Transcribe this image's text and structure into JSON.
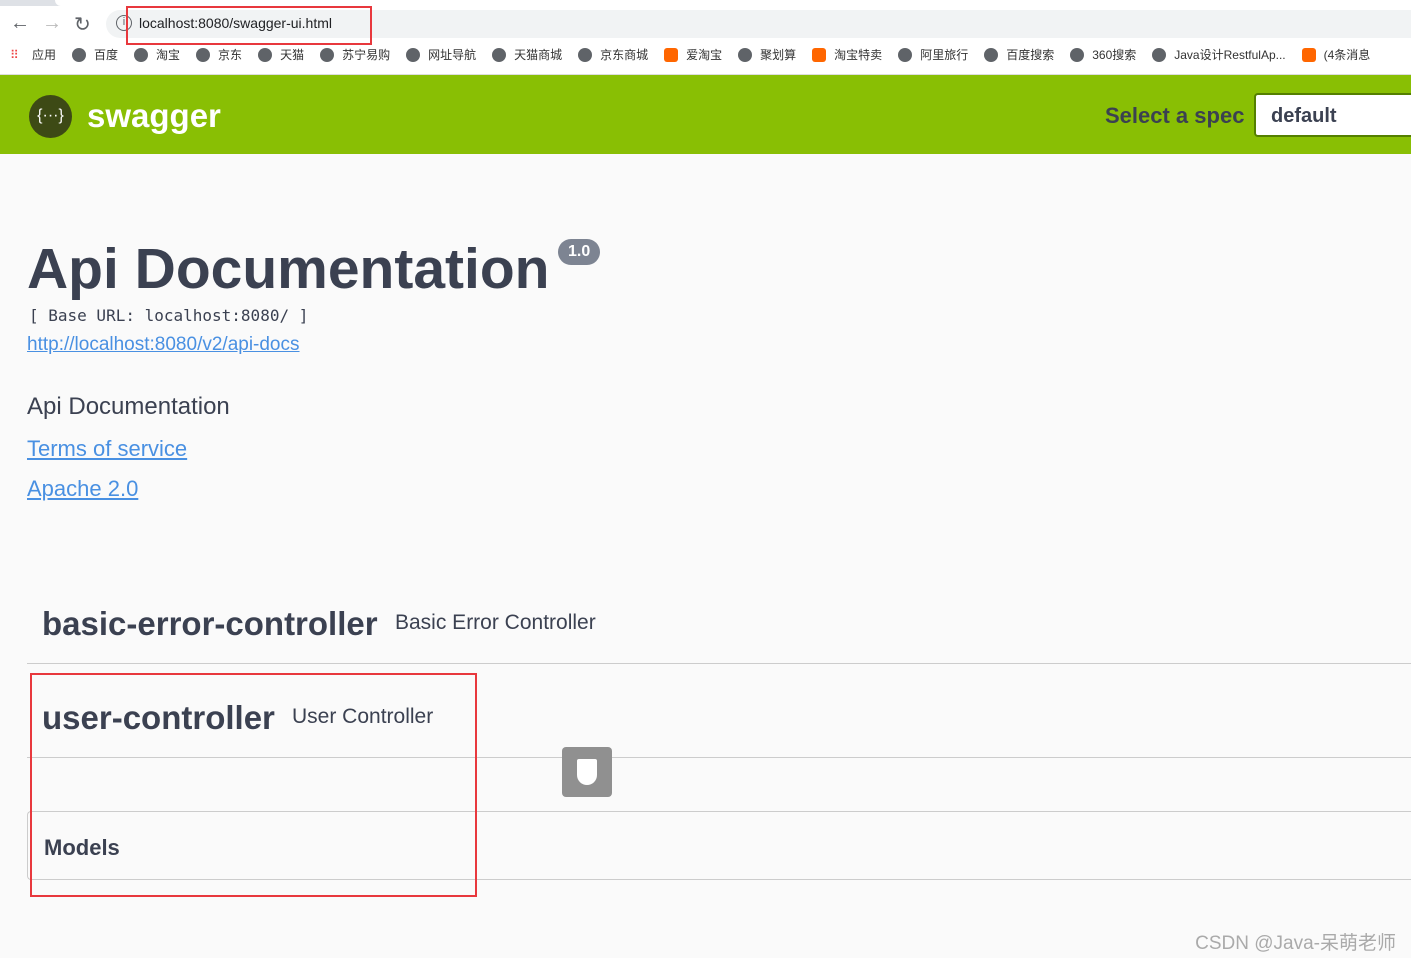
{
  "browser": {
    "url": "localhost:8080/swagger-ui.html",
    "bookmarks": [
      "应用",
      "百度",
      "淘宝",
      "京东",
      "天猫",
      "苏宁易购",
      "网址导航",
      "天猫商城",
      "京东商城",
      "爱淘宝",
      "聚划算",
      "淘宝特卖",
      "阿里旅行",
      "百度搜索",
      "360搜索",
      "Java设计RestfulAp...",
      "(4条消息"
    ]
  },
  "topbar": {
    "brand": "swagger",
    "logo_text": "{···}",
    "spec_label": "Select a spec",
    "spec_value": "default",
    "color": "#89bf04"
  },
  "info": {
    "title": "Api Documentation",
    "version": "1.0",
    "base_url": "[ Base URL: localhost:8080/ ]",
    "api_docs_link": "http://localhost:8080/v2/api-docs",
    "description": "Api Documentation",
    "terms": "Terms of service",
    "license": "Apache 2.0"
  },
  "tags": [
    {
      "name": "basic-error-controller",
      "description": "Basic Error Controller"
    },
    {
      "name": "user-controller",
      "description": "User Controller"
    }
  ],
  "models": {
    "label": "Models"
  },
  "watermark": "CSDN @Java-呆萌老师"
}
